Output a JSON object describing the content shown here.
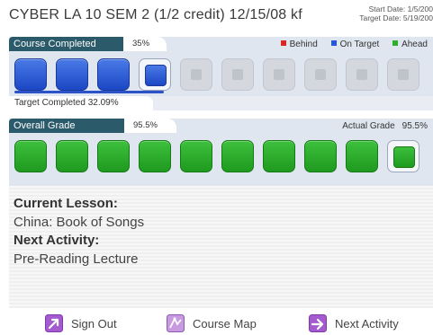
{
  "header": {
    "course_title": "CYBER LA 10 SEM 2 (1/2 credit) 12/15/08 kf",
    "start_date": "Start Date: 1/5/200",
    "target_date": "Target Date: 5/19/200"
  },
  "course_progress": {
    "tab_label": "Course Completed",
    "percent_text": "35%",
    "percent_value": 35,
    "legend": [
      {
        "label": "Behind",
        "color": "#d9281f"
      },
      {
        "label": "On Target",
        "color": "#2557d6"
      },
      {
        "label": "Ahead",
        "color": "#2fad2f"
      }
    ],
    "blocks": [
      "blue",
      "blue",
      "blue",
      "current",
      "gray",
      "gray",
      "gray",
      "gray",
      "gray",
      "gray"
    ],
    "target_text": "Target Completed 32.09%",
    "target_value": 32.09
  },
  "grade_progress": {
    "tab_label": "Overall Grade",
    "percent_text": "95.5%",
    "percent_value": 95.5,
    "actual_label": "Actual Grade",
    "actual_value_text": "95.5%",
    "blocks": [
      "green",
      "green",
      "green",
      "green",
      "green",
      "green",
      "green",
      "green",
      "green",
      "current-green"
    ]
  },
  "lesson": {
    "current_lesson_label": "Current Lesson:",
    "current_lesson_value": "China: Book of Songs",
    "next_activity_label": "Next Activity:",
    "next_activity_value": "Pre-Reading Lecture"
  },
  "footer": {
    "sign_out": {
      "label": "Sign Out",
      "icon": "sign-out-icon"
    },
    "course_map": {
      "label": "Course Map",
      "icon": "course-map-icon"
    },
    "next_activity": {
      "label": "Next Activity",
      "icon": "next-activity-icon"
    }
  },
  "colors": {
    "panel_tab": "#2b5a6a",
    "on_target_blue": "#2557d6",
    "ahead_green": "#2fad2f",
    "nav_icon": "#9b55c9"
  }
}
